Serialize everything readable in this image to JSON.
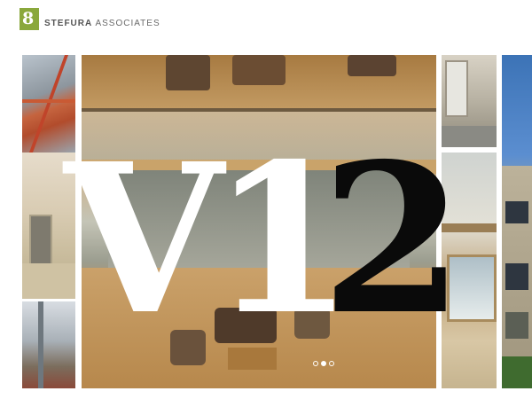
{
  "brand": {
    "logo_mark": "8",
    "name_bold": "STEFURA",
    "name_rest": "ASSOCIATES",
    "accent_color": "#8aa83c"
  },
  "hero": {
    "title_white": "V1",
    "title_black": "2"
  },
  "carousel": {
    "total_slides": 3,
    "active_slide": 2
  }
}
